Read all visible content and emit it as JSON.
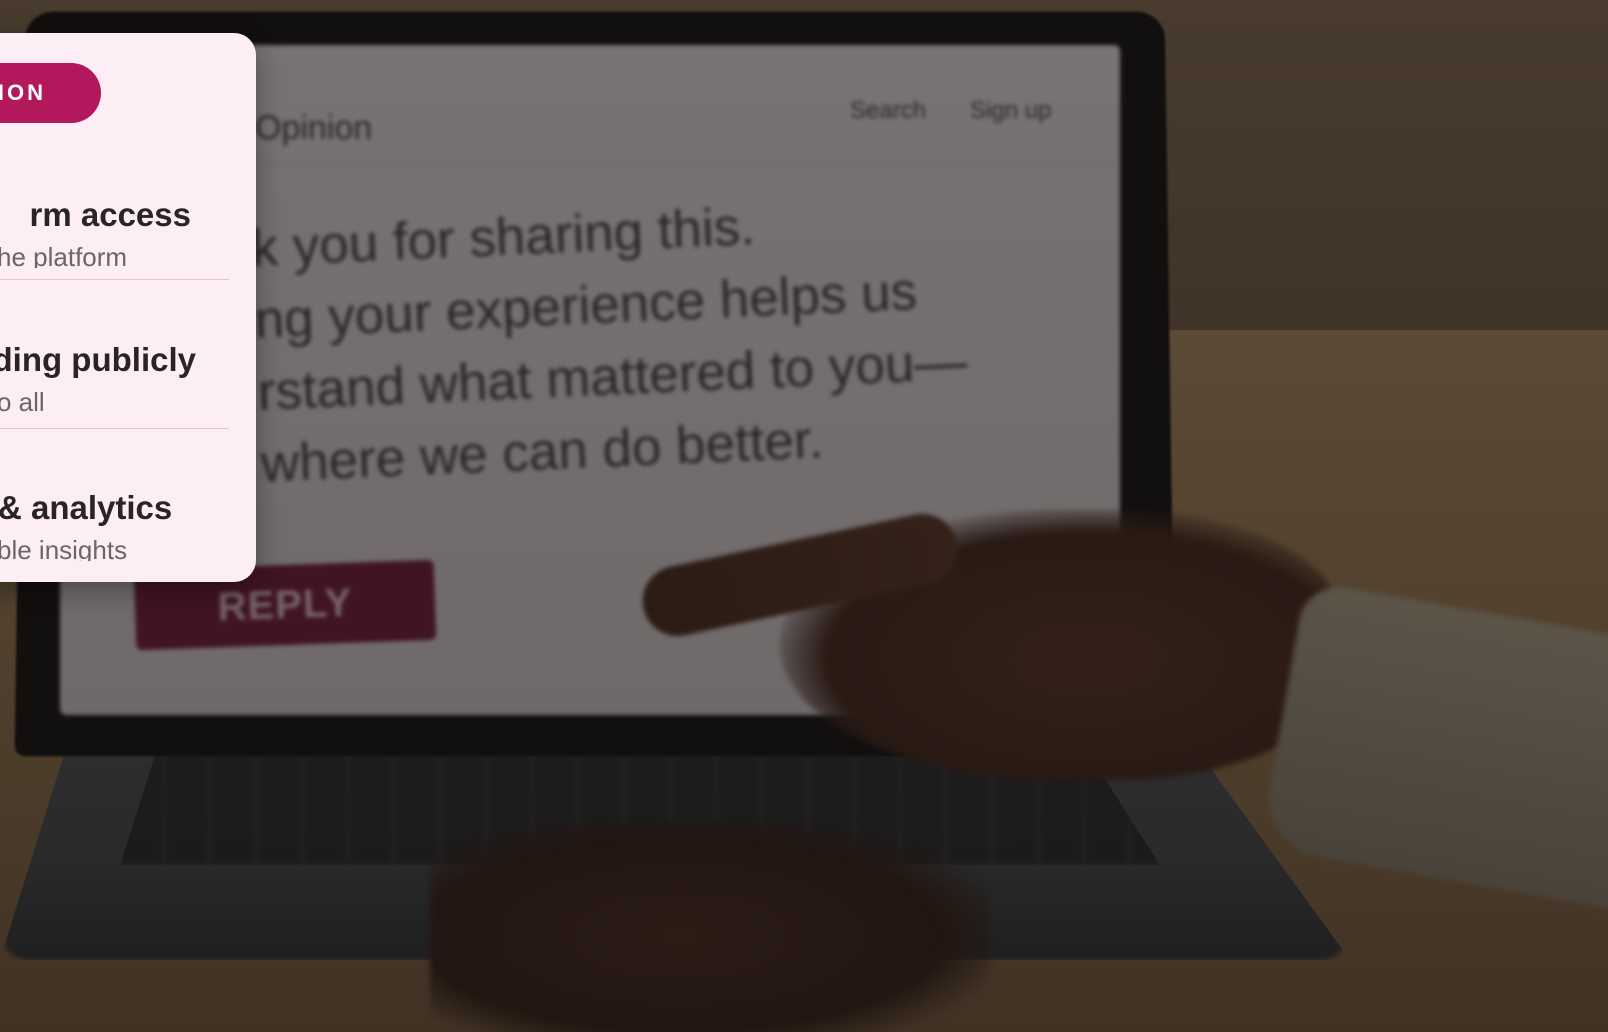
{
  "card": {
    "badge": "ION",
    "features": [
      {
        "title": "rm access",
        "desc": "he platform"
      },
      {
        "title": "nding publicly",
        "desc": "o all"
      },
      {
        "title": "& analytics",
        "desc": "ble insights"
      }
    ]
  },
  "laptop_site": {
    "logo": "Opinion",
    "nav": {
      "search": "Search",
      "signup": "Sign up"
    },
    "message_lines": [
      "k you for sharing this.",
      "ng your experience helps us",
      "rstand what mattered to you—",
      "where we can do better."
    ],
    "reply_label": "REPLY"
  },
  "colors": {
    "accent": "#b3175c",
    "card_bg": "#fdeef5",
    "reply_bg": "#5f1b32"
  }
}
